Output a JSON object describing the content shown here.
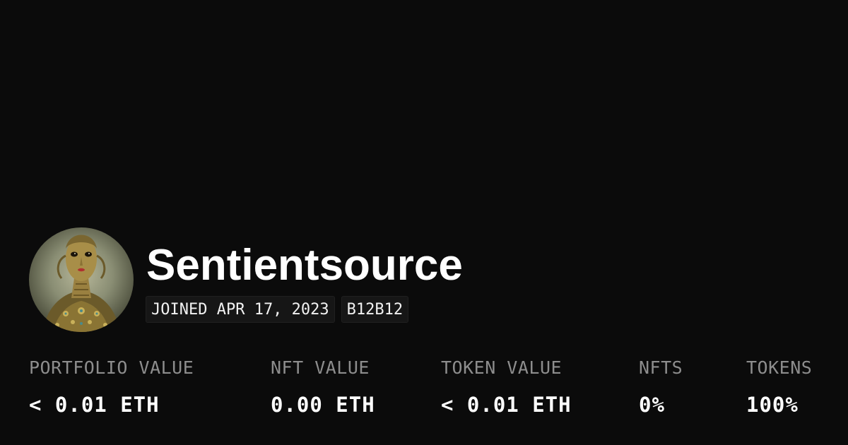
{
  "profile": {
    "name": "Sentientsource",
    "joined": "JOINED APR 17, 2023",
    "badge": "B12B12"
  },
  "stats": [
    {
      "label": "PORTFOLIO VALUE",
      "value": "< 0.01 ETH"
    },
    {
      "label": "NFT VALUE",
      "value": "0.00 ETH"
    },
    {
      "label": "TOKEN VALUE",
      "value": "< 0.01 ETH"
    },
    {
      "label": "NFTS",
      "value": "0%"
    },
    {
      "label": "TOKENS",
      "value": "100%"
    }
  ],
  "colors": {
    "background": "#0b0b0b",
    "text": "#ffffff",
    "muted": "#8d8d8d",
    "tag_background": "#161616"
  }
}
